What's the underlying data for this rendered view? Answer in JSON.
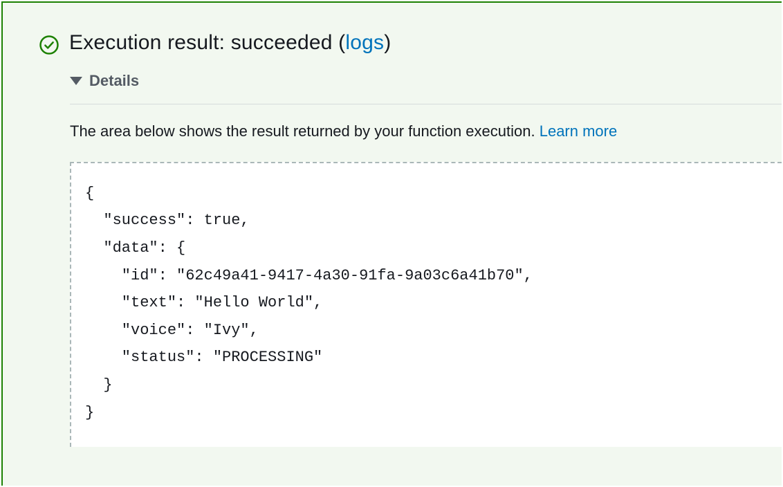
{
  "header": {
    "title_prefix": "Execution result: succeeded (",
    "logs_label": "logs",
    "title_suffix": ")"
  },
  "details": {
    "toggle_label": "Details",
    "description_text": "The area below shows the result returned by your function execution. ",
    "learn_more_label": "Learn more"
  },
  "result": {
    "success": true,
    "data": {
      "id": "62c49a41-9417-4a30-91fa-9a03c6a41b70",
      "text": "Hello World",
      "voice": "Ivy",
      "status": "PROCESSING"
    }
  },
  "colors": {
    "success_border": "#1d8102",
    "success_bg": "#f2f8f0",
    "link": "#0073bb"
  }
}
